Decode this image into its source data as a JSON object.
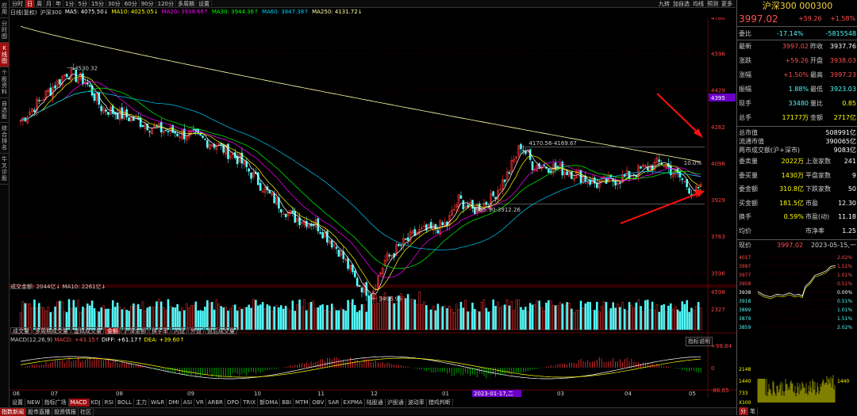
{
  "sidebar": {
    "items": [
      "应用",
      "分时图",
      "K线图",
      "个股资料",
      "自选股",
      "综合排名",
      "牛叉诊股"
    ],
    "active": 2
  },
  "period_tabs": [
    "分时",
    "日",
    "周",
    "月",
    "年",
    "1分",
    "5分",
    "15分",
    "30分",
    "60分",
    "90分",
    "120分",
    "多周期",
    "设置"
  ],
  "period_active": 1,
  "right_tools": [
    "九转",
    "加自选",
    "均线",
    "预测",
    "更多"
  ],
  "ma_line": {
    "label": "日线(复权)",
    "name": "沪深300",
    "ma5": "MA5: 4075.50↓",
    "ma10": "MA10: 4025.05↓",
    "ma20": "MA20: 3939.66↑",
    "ma30": "MA30: 3944.36↑",
    "ma60": "MA60: 3847.38↑",
    "ma250": "MA250: 4131.72↓"
  },
  "colors": {
    "up": "#ff3232",
    "down": "#54fcfc",
    "ma5": "#ffffff",
    "ma10": "#ffff00",
    "ma20": "#ff00ff",
    "ma30": "#00ff00",
    "ma60": "#00ccff",
    "ma250": "#ffffa8",
    "price": "#ff5050",
    "title": "#f0d040"
  },
  "price_axis": [
    "4760",
    "4596",
    "4429",
    "4262",
    "4096",
    "3929",
    "3763",
    "3596"
  ],
  "current_price_tag": "4395",
  "annotations": {
    "high": "4530.32",
    "low": "3495.95",
    "range1": "4170.56-4169.67",
    "range2": "3905.90-3912.26",
    "pct": "10.0%"
  },
  "volume": {
    "title": "成交金额: 2044亿↓ MA10: 2261亿↓",
    "axis": [
      "4598",
      "2327"
    ]
  },
  "subtabs": [
    "成交量",
    "多周期成交量",
    "虚拟成交量",
    "金额",
    "沪深金额",
    "换手率",
    "内盘",
    "外盘",
    "盘后成交量"
  ],
  "subtab_active": 3,
  "macd": {
    "title_prefix": "MACD(12,26,9)",
    "macd": "MACD: +43.15↑",
    "diff": "DIFF: +61.17↑",
    "dea": "DEA: +39.60↑",
    "axis": [
      "+99.84",
      "0",
      "-86.65"
    ],
    "button": "指标说明"
  },
  "date_axis": [
    "06",
    "07",
    "08",
    "09",
    "10",
    "11",
    "12",
    "01",
    "2023-01-17,二",
    "03",
    "04",
    "05"
  ],
  "indicator_tabs": [
    "设置",
    "NEW",
    "指标广场",
    "MACD",
    "KDJ",
    "RSI",
    "BOLL",
    "主力",
    "W&R",
    "DMI",
    "ASI",
    "VR",
    "ARBR",
    "DPO",
    "TRIX",
    "新DMA",
    "BBI",
    "MTM",
    "OBV",
    "SAR",
    "EXPMA",
    "陆股通",
    "沪股通",
    "波动率",
    "猎鸡判断"
  ],
  "indicator_active": 3,
  "bottom_tabs": [
    "指数新闻",
    "股市直播",
    "投资情报",
    "社区"
  ],
  "stock": {
    "name": "沪深300 000300",
    "price": "3997.02",
    "change": "+59.26",
    "pct": "+1.58%"
  },
  "quote": {
    "weibi": {
      "label": "委比",
      "v1": "-17.14%",
      "v2": "-5815548"
    },
    "rows": [
      {
        "l1": "最新",
        "v1": "3997.02",
        "l2": "昨收",
        "v2": "3937.76",
        "c1": "#ff5050",
        "c2": "#ffffff"
      },
      {
        "l1": "涨跌",
        "v1": "+59.26",
        "l2": "开盘",
        "v2": "3938.03",
        "c1": "#ff5050",
        "c2": "#ff5050"
      },
      {
        "l1": "涨幅",
        "v1": "+1.50%",
        "l2": "最高",
        "v2": "3997.23",
        "c1": "#ff5050",
        "c2": "#ff5050"
      },
      {
        "l1": "振幅",
        "v1": "1.88%",
        "l2": "最低",
        "v2": "3923.03",
        "c1": "#54fcfc",
        "c2": "#54fcfc"
      },
      {
        "l1": "现手",
        "v1": "33480",
        "l2": "量比",
        "v2": "0.85",
        "c1": "#54fcfc",
        "c2": "#ffff00"
      },
      {
        "l1": "总手",
        "v1": "17177万",
        "l2": "金额",
        "v2": "2717亿",
        "c1": "#ffff00",
        "c2": "#ffff00"
      }
    ],
    "info": [
      {
        "l": "总市值",
        "v": "508991亿"
      },
      {
        "l": "流通市值",
        "v": "390065亿"
      },
      {
        "l": "两市成交额(沪+深市)",
        "v": "9083亿"
      },
      {
        "l": "委卖量",
        "v": "2022万",
        "l2": "上涨家数",
        "v2": "241"
      },
      {
        "l": "委买量",
        "v": "1430万",
        "l2": "平盘家数",
        "v2": "9"
      },
      {
        "l": "委金额",
        "v": "310.8亿",
        "l2": "下跌家数",
        "v2": "50"
      },
      {
        "l": "买金额",
        "v": "181.5亿",
        "l2": "市盈",
        "v2": "12.30"
      },
      {
        "l": "换手",
        "v": "0.59%",
        "l2": "市盈(动)",
        "v2": "11.18"
      },
      {
        "l": "均价",
        "v": "",
        "l2": "市净率",
        "v2": "1.25"
      }
    ],
    "now": {
      "label": "现价",
      "price": "3997.02",
      "date": "2023-05-15,一"
    }
  },
  "mini_chart": {
    "left_axis": [
      "4017",
      "3997",
      "3977",
      "3958",
      "3938",
      "3918",
      "3899",
      "3879",
      "3859"
    ],
    "right_axis": [
      "2.02%",
      "1.51%",
      "1.01%",
      "0.51%",
      "0.00%",
      "0.51%",
      "1.01%",
      "1.51%",
      "2.02%"
    ],
    "vol_axis": [
      "2148",
      "1440",
      "733",
      "X100"
    ],
    "vol_right": [
      "1440"
    ]
  },
  "right_bottom_tabs": [
    "分",
    "笔"
  ]
}
